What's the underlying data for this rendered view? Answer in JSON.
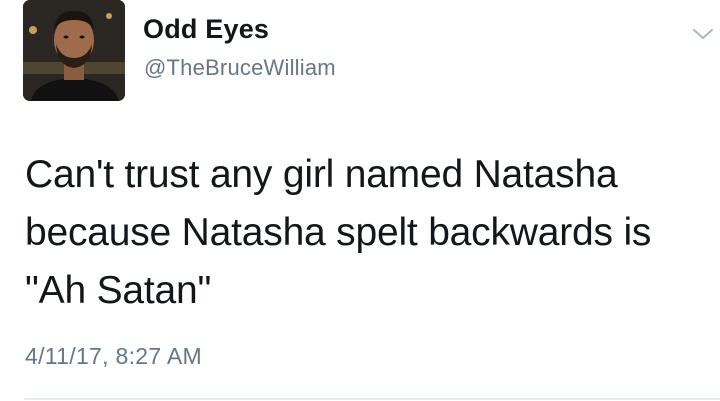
{
  "author": {
    "display_name": "Odd Eyes",
    "handle": "@TheBruceWilliam",
    "avatar_icon": "profile-photo"
  },
  "tweet": {
    "text_lines": [
      "Can't trust any girl named Natasha",
      "because Natasha spelt backwards is",
      "\"Ah Satan\""
    ],
    "timestamp": "4/11/17, 8:27 AM"
  },
  "menu": {
    "icon": "chevron-down-icon"
  },
  "colors": {
    "text": "#14171a",
    "secondary": "#657786",
    "divider": "#e6ecf0"
  }
}
